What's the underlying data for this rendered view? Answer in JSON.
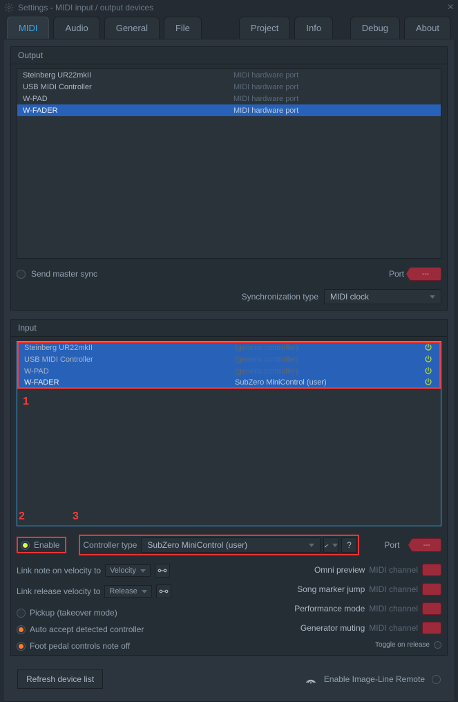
{
  "window": {
    "title": "Settings - MIDI input / output devices"
  },
  "tabs": [
    "MIDI",
    "Audio",
    "General",
    "File",
    "Project",
    "Info",
    "Debug",
    "About"
  ],
  "active_tab": 0,
  "output_panel": {
    "title": "Output",
    "devices": [
      {
        "name": "Steinberg UR22mkII",
        "type": "MIDI hardware port"
      },
      {
        "name": "USB MIDI Controller",
        "type": "MIDI hardware port"
      },
      {
        "name": "W-PAD",
        "type": "MIDI hardware port"
      },
      {
        "name": "W-FADER",
        "type": "MIDI hardware port"
      }
    ],
    "selected_index": 3,
    "send_master_sync": "Send master sync",
    "port_label": "Port",
    "port_value": "---",
    "sync_type_label": "Synchronization type",
    "sync_type_value": "MIDI clock"
  },
  "input_panel": {
    "title": "Input",
    "devices": [
      {
        "name": "Steinberg UR22mkII",
        "type": "(generic controller)"
      },
      {
        "name": "USB MIDI Controller",
        "type": "(generic controller)"
      },
      {
        "name": "W-PAD",
        "type": "(generic controller)"
      },
      {
        "name": "W-FADER",
        "type": "SubZero MiniControl (user)"
      }
    ],
    "selected_index": 3,
    "annotations": {
      "one": "1",
      "two": "2",
      "three": "3"
    },
    "enable_label": "Enable",
    "controller_type_label": "Controller type",
    "controller_type_value": "SubZero MiniControl (user)",
    "port_label": "Port",
    "port_value": "---",
    "link_note_on_label": "Link note on velocity to",
    "link_note_on_value": "Velocity",
    "link_release_label": "Link release velocity to",
    "link_release_value": "Release",
    "pickup_label": "Pickup (takeover mode)",
    "auto_accept_label": "Auto accept detected controller",
    "foot_pedal_label": "Foot pedal controls note off",
    "omni_preview_label": "Omni preview",
    "song_marker_label": "Song marker jump",
    "performance_label": "Performance mode",
    "generator_muting_label": "Generator muting",
    "midi_channel_suffix": "MIDI channel",
    "toggle_on_release_label": "Toggle on release"
  },
  "footer": {
    "refresh_label": "Refresh device list",
    "enable_remote_label": "Enable Image-Line Remote"
  }
}
